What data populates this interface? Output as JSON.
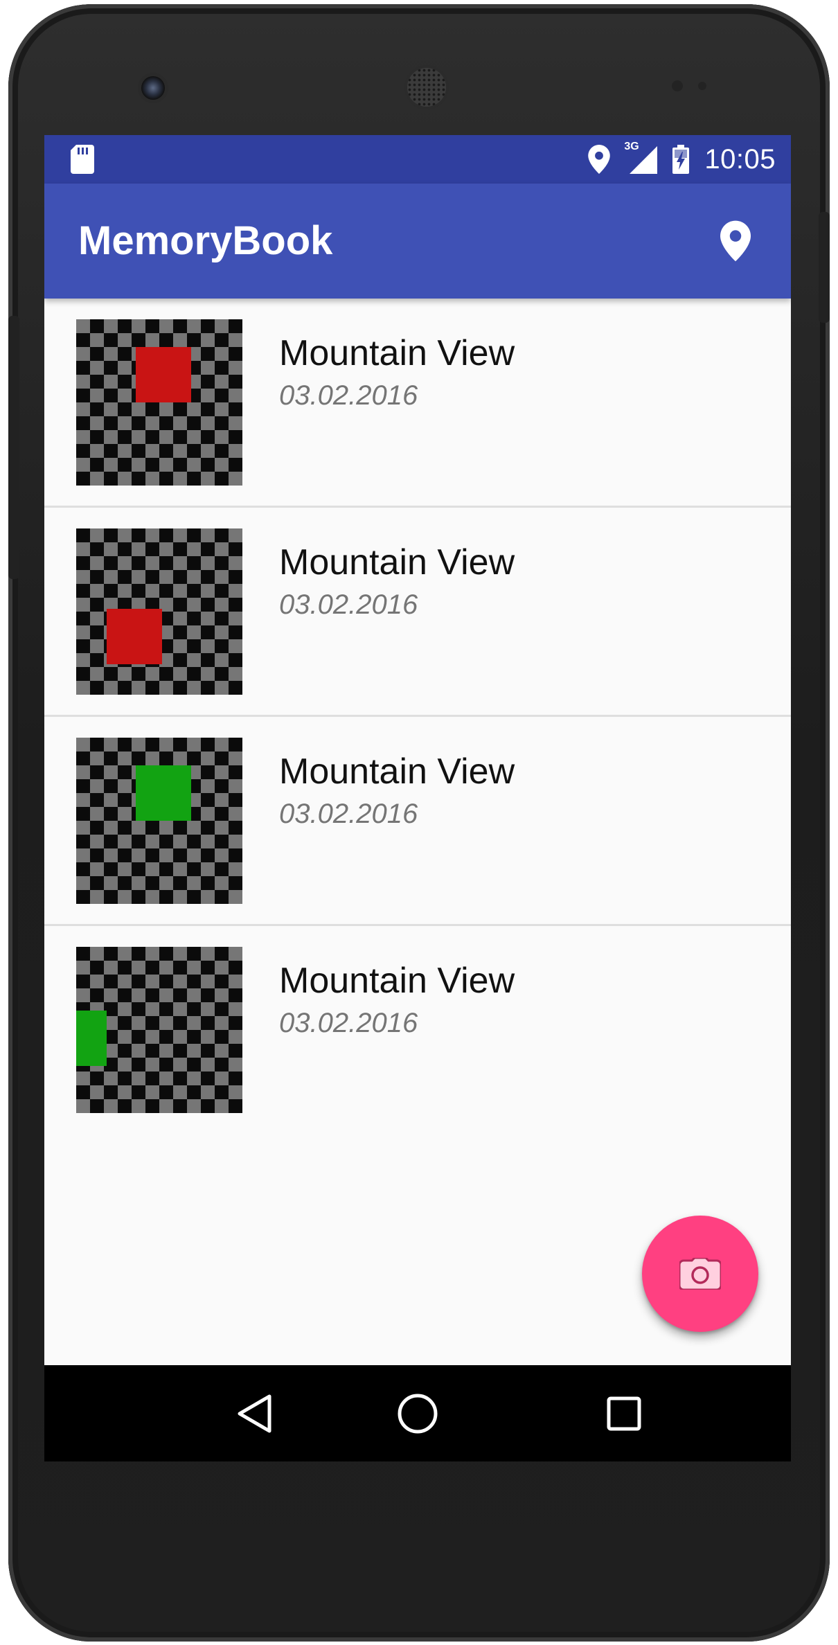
{
  "status_bar": {
    "time": "10:05",
    "network": "3G",
    "icons": [
      "sd-card-icon",
      "location-icon",
      "signal-icon",
      "battery-charging-icon"
    ]
  },
  "app_bar": {
    "title": "MemoryBook",
    "action_icon": "location-pin-icon"
  },
  "memories": [
    {
      "title": "Mountain View",
      "date": "03.02.2016",
      "marker_color": "#c91414"
    },
    {
      "title": "Mountain View",
      "date": "03.02.2016",
      "marker_color": "#c91414"
    },
    {
      "title": "Mountain View",
      "date": "03.02.2016",
      "marker_color": "#12a312"
    },
    {
      "title": "Mountain View",
      "date": "03.02.2016",
      "marker_color": "#12a312"
    }
  ],
  "fab": {
    "icon": "camera-icon"
  },
  "nav_bar": {
    "buttons": [
      "back-icon",
      "home-icon",
      "recents-icon"
    ]
  },
  "colors": {
    "primary": "#3f51b5",
    "primary_dark": "#303f9f",
    "accent": "#ff4081",
    "list_background": "#fafafa"
  }
}
